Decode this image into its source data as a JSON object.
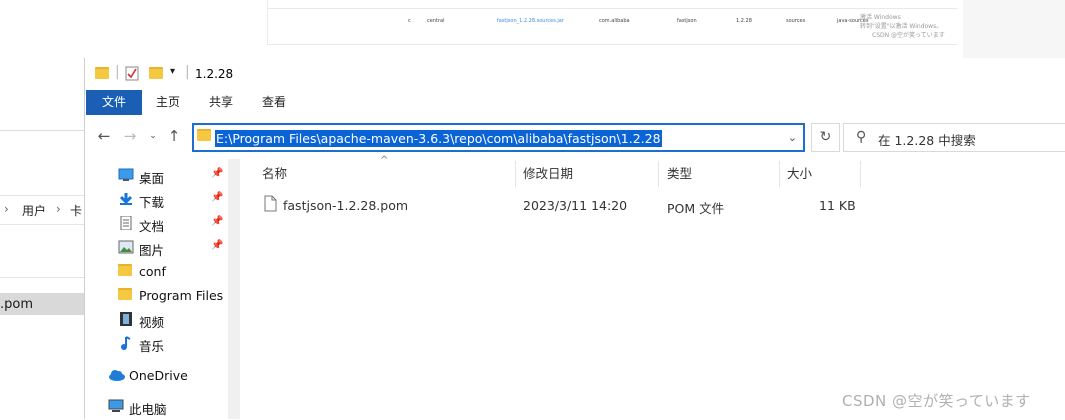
{
  "background_page": {
    "row_cells": [
      "c",
      "central",
      "fastjson_1.2.28.sources.jar",
      "com.alibaba",
      "fastjson",
      "1.2.28",
      "sources",
      "java-sources"
    ],
    "watermark_lines": [
      "激活 Windows",
      "转到\"设置\"以激活 Windows。",
      "CSDN @空が笑っています"
    ]
  },
  "background_explorer": {
    "crumb_1": "用户",
    "crumb_2": "卡",
    "selected_item": ".pom"
  },
  "window": {
    "title": "1.2.28",
    "ribbon_tabs": [
      "文件",
      "主页",
      "共享",
      "查看"
    ]
  },
  "navbar": {
    "address_path": "E:\\Program Files\\apache-maven-3.6.3\\repo\\com\\alibaba\\fastjson\\1.2.28",
    "search_placeholder": "在 1.2.28 中搜索"
  },
  "nav_pane": [
    {
      "label": "桌面",
      "icon": "desktop-icon",
      "pinned": true
    },
    {
      "label": "下载",
      "icon": "download-icon",
      "pinned": true
    },
    {
      "label": "文档",
      "icon": "document-icon",
      "pinned": true
    },
    {
      "label": "图片",
      "icon": "pictures-icon",
      "pinned": true
    },
    {
      "label": "conf",
      "icon": "folder-icon",
      "pinned": false
    },
    {
      "label": "Program Files",
      "icon": "folder-icon",
      "pinned": false
    },
    {
      "label": "视频",
      "icon": "video-icon",
      "pinned": false
    },
    {
      "label": "音乐",
      "icon": "music-icon",
      "pinned": false
    },
    {
      "label": "OneDrive",
      "icon": "onedrive-icon",
      "pinned": false
    },
    {
      "label": "此电脑",
      "icon": "this-pc-icon",
      "pinned": false
    }
  ],
  "file_list": {
    "columns": [
      "名称",
      "修改日期",
      "类型",
      "大小"
    ],
    "rows": [
      {
        "name": "fastjson-1.2.28.pom",
        "modified": "2023/3/11 14:20",
        "type": "POM 文件",
        "size": "11 KB"
      }
    ]
  },
  "watermark": "CSDN @空が笑っています",
  "colors": {
    "accent": "#1a5fb4",
    "selection": "#0a64d6",
    "folder": "#f5c842"
  }
}
